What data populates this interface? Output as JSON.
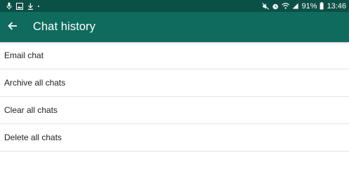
{
  "status_bar": {
    "battery_percent": "91%",
    "time": "13:46",
    "left_icons": [
      "mic-icon",
      "image-icon",
      "download-icon",
      "dot-icon"
    ],
    "right_icons": [
      "mute-icon",
      "alarm-icon",
      "wifi-icon",
      "signal-icon",
      "battery-icon"
    ]
  },
  "toolbar": {
    "title": "Chat history",
    "back_icon": "arrow-left-icon",
    "background": "#0e6b5e",
    "status_background": "#0b5046"
  },
  "menu": {
    "items": [
      {
        "label": "Email chat"
      },
      {
        "label": "Archive all chats"
      },
      {
        "label": "Clear all chats"
      },
      {
        "label": "Delete all chats"
      }
    ]
  }
}
